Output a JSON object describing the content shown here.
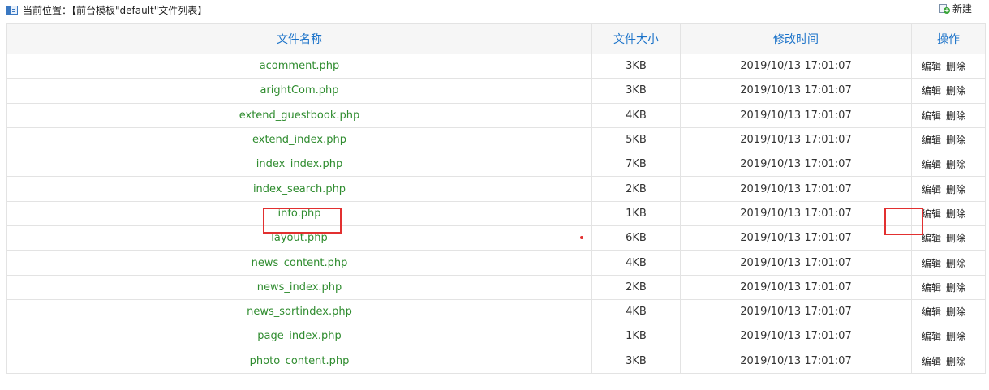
{
  "breadcrumb": {
    "icon": "panel-icon",
    "text": "当前位置：【前台模板\"default\"文件列表】"
  },
  "toolbar": {
    "new_label": "新建",
    "new_icon": "new-file-icon"
  },
  "table": {
    "headers": [
      "文件名称",
      "文件大小",
      "修改时间",
      "操作"
    ],
    "action_labels": [
      "编辑",
      "删除"
    ],
    "rows": [
      {
        "name": "acomment.php",
        "size": "3KB",
        "time": "2019/10/13 17:01:07"
      },
      {
        "name": "arightCom.php",
        "size": "3KB",
        "time": "2019/10/13 17:01:07"
      },
      {
        "name": "extend_guestbook.php",
        "size": "4KB",
        "time": "2019/10/13 17:01:07"
      },
      {
        "name": "extend_index.php",
        "size": "5KB",
        "time": "2019/10/13 17:01:07"
      },
      {
        "name": "index_index.php",
        "size": "7KB",
        "time": "2019/10/13 17:01:07"
      },
      {
        "name": "index_search.php",
        "size": "2KB",
        "time": "2019/10/13 17:01:07"
      },
      {
        "name": "info.php",
        "size": "1KB",
        "time": "2019/10/13 17:01:07"
      },
      {
        "name": "layout.php",
        "size": "6KB",
        "time": "2019/10/13 17:01:07"
      },
      {
        "name": "news_content.php",
        "size": "4KB",
        "time": "2019/10/13 17:01:07"
      },
      {
        "name": "news_index.php",
        "size": "2KB",
        "time": "2019/10/13 17:01:07"
      },
      {
        "name": "news_sortindex.php",
        "size": "4KB",
        "time": "2019/10/13 17:01:07"
      },
      {
        "name": "page_index.php",
        "size": "1KB",
        "time": "2019/10/13 17:01:07"
      },
      {
        "name": "photo_content.php",
        "size": "3KB",
        "time": "2019/10/13 17:01:07"
      }
    ]
  },
  "colors": {
    "header_text": "#1a72c9",
    "filename_text": "#2f8c2f",
    "annotation": "#e23030"
  }
}
